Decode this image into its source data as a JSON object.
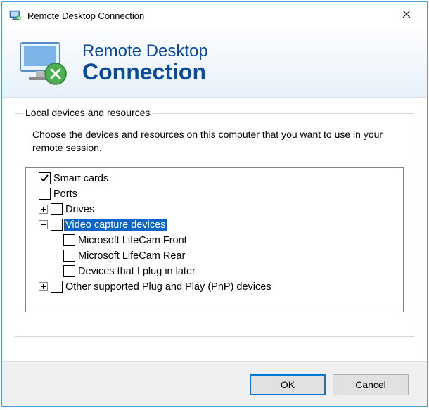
{
  "window": {
    "title": "Remote Desktop Connection",
    "close_icon": "close"
  },
  "header": {
    "line1": "Remote Desktop",
    "line2": "Connection"
  },
  "group": {
    "title": "Local devices and resources",
    "instructions": "Choose the devices and resources on this computer that you want to use in your remote session."
  },
  "tree": {
    "items": [
      {
        "label": "Smart cards",
        "checked": true,
        "expander": "none",
        "indent": 0
      },
      {
        "label": "Ports",
        "checked": false,
        "expander": "none",
        "indent": 0
      },
      {
        "label": "Drives",
        "checked": false,
        "expander": "plus",
        "indent": 1
      },
      {
        "label": "Video capture devices",
        "checked": false,
        "expander": "minus",
        "indent": 1,
        "selected": true
      },
      {
        "label": "Microsoft LifeCam Front",
        "checked": false,
        "expander": "none",
        "indent": 2
      },
      {
        "label": "Microsoft LifeCam Rear",
        "checked": false,
        "expander": "none",
        "indent": 2
      },
      {
        "label": "Devices that I plug in later",
        "checked": false,
        "expander": "none",
        "indent": 2
      },
      {
        "label": "Other supported Plug and Play (PnP) devices",
        "checked": false,
        "expander": "plus",
        "indent": 1
      }
    ]
  },
  "buttons": {
    "ok": "OK",
    "cancel": "Cancel"
  }
}
